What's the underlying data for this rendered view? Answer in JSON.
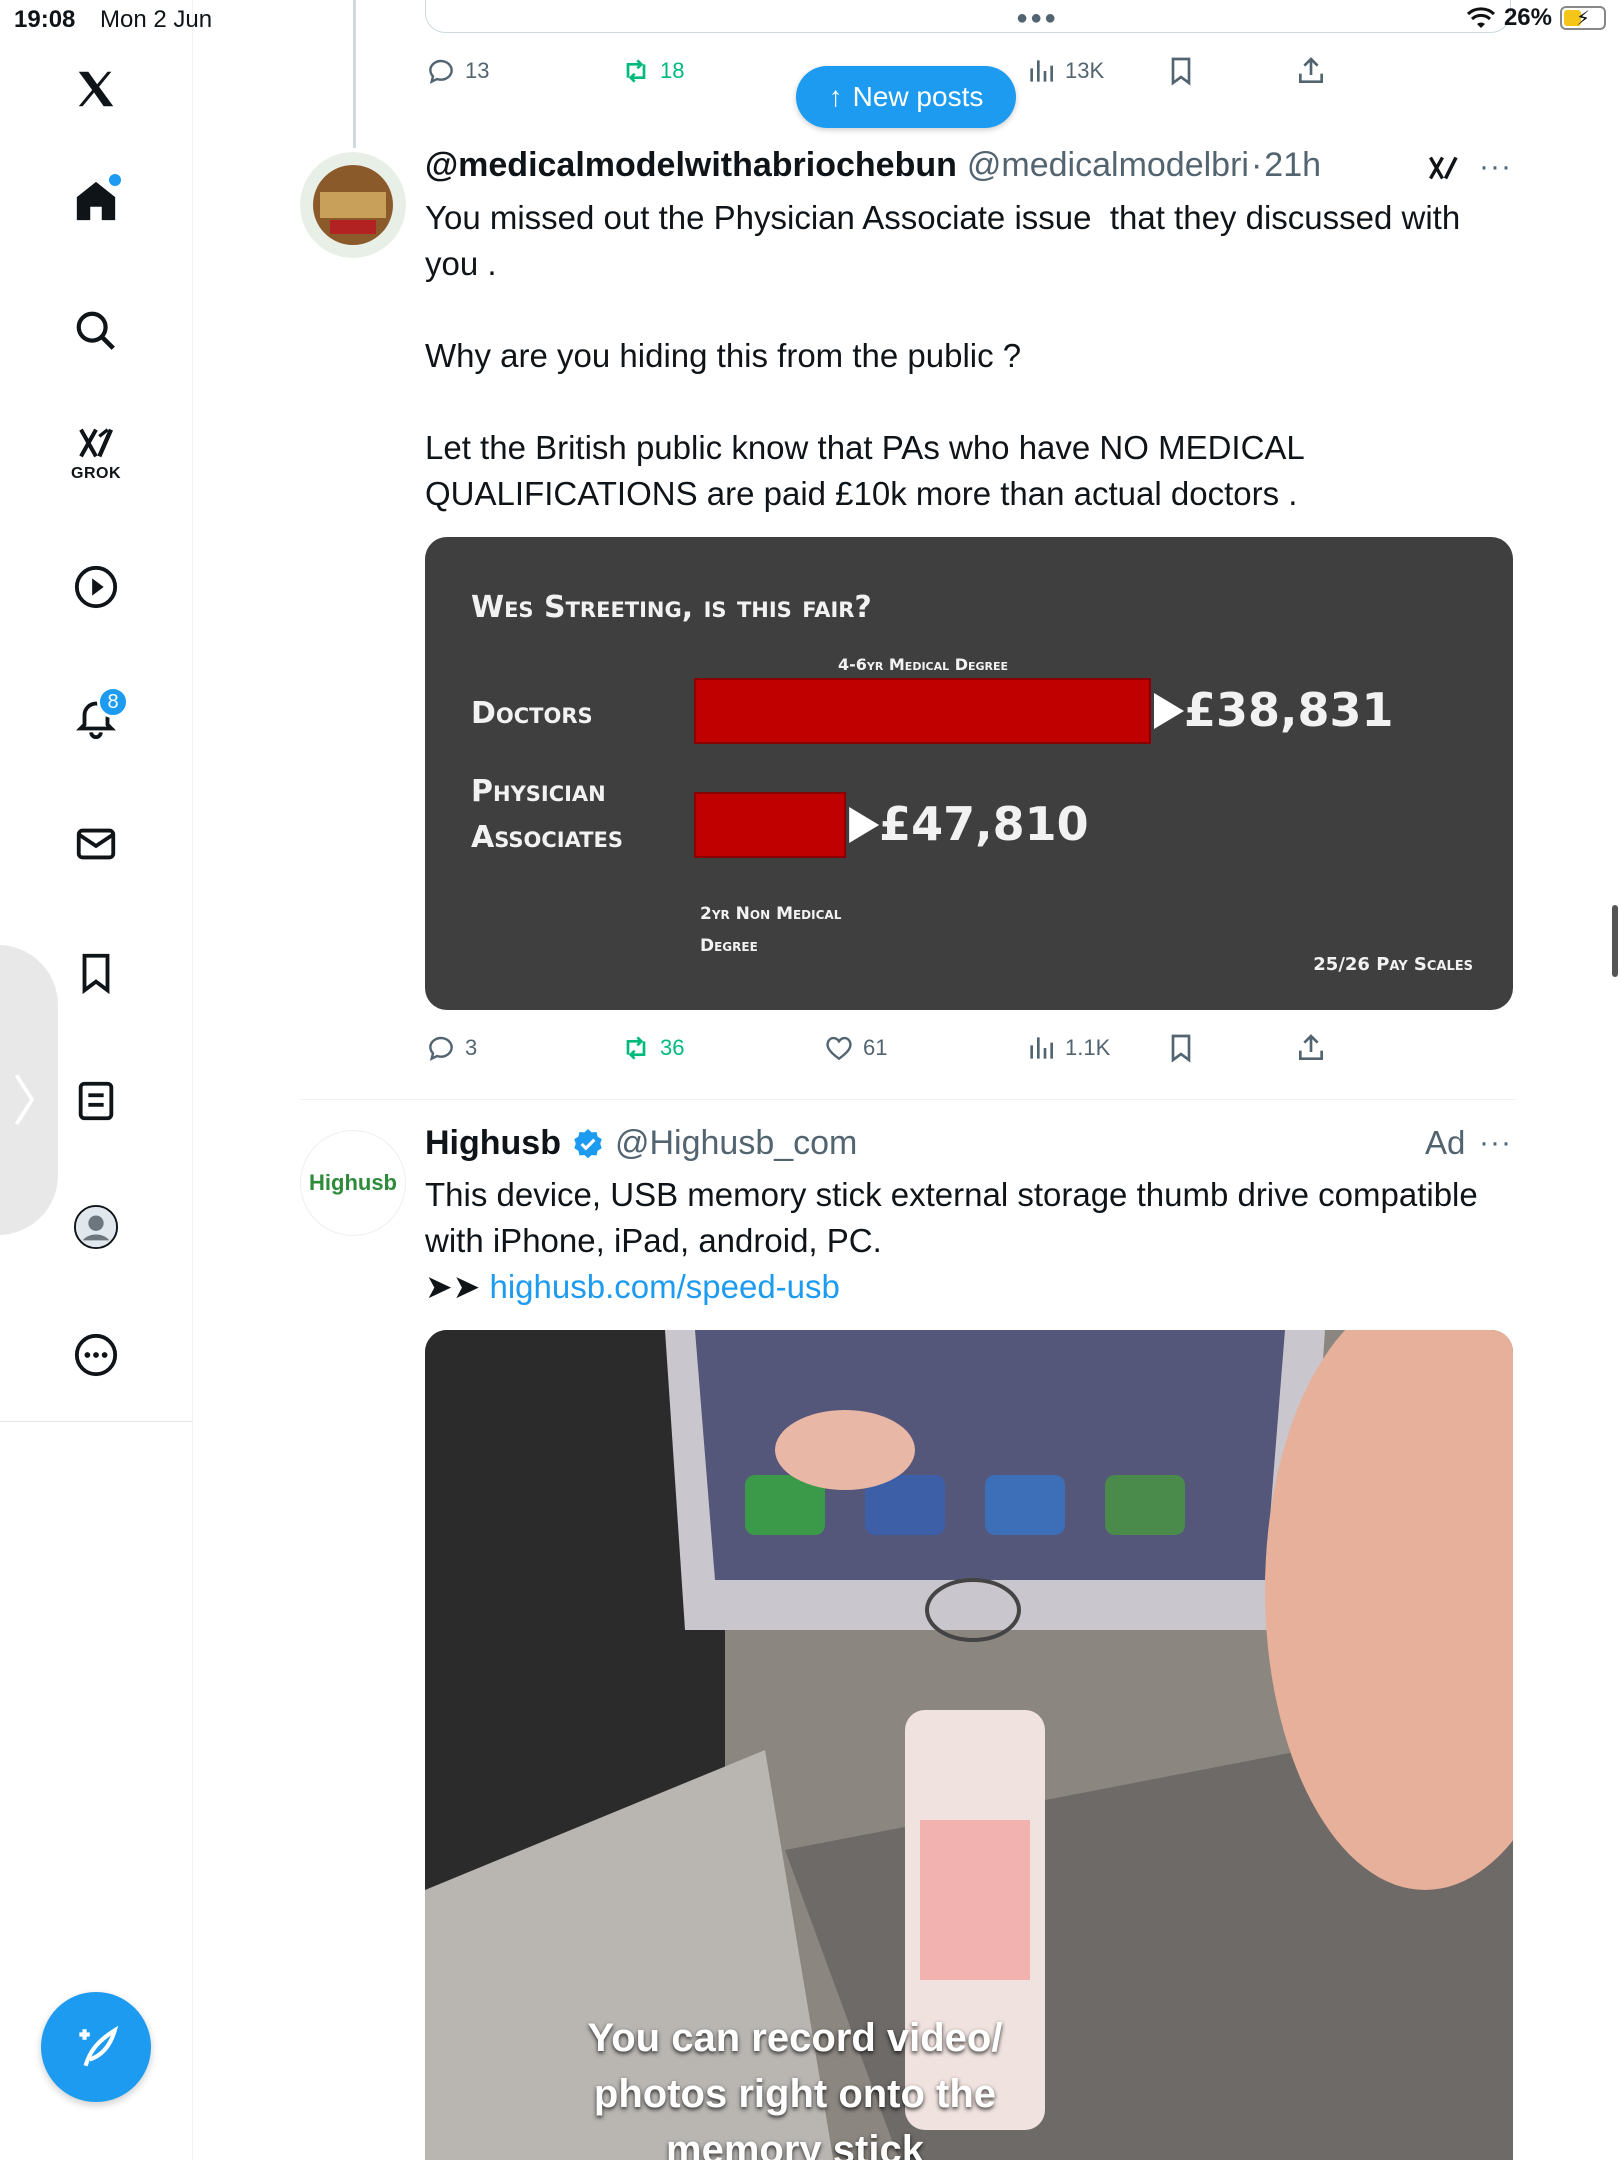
{
  "status_bar": {
    "time": "19:08",
    "date": "Mon 2 Jun",
    "battery": "26%"
  },
  "sidebar": {
    "grok_label": "GROK",
    "notifications_badge": "8"
  },
  "new_posts_label": "New posts",
  "prev_tweet_actions": {
    "replies": "13",
    "reposts": "18",
    "views": "13K"
  },
  "tweet": {
    "display_name": "@medicalmodelwithabriochebun",
    "handle": "@medicalmodelbri",
    "separator": "·",
    "time": "21h",
    "text": "You missed out the Physician Associate issue  that they discussed with you .\n\nWhy are you hiding this from the public ?\n\nLet the British public know that PAs who have NO MEDICAL QUALIFICATIONS are paid £10k more than actual doctors .",
    "actions": {
      "replies": "3",
      "reposts": "36",
      "likes": "61",
      "views": "1.1K"
    }
  },
  "chart_data": {
    "type": "bar",
    "orientation": "horizontal",
    "title": "Wes Streeting, is this fair?",
    "categories": [
      "Doctors",
      "Physician Associates"
    ],
    "values": [
      38831,
      47810
    ],
    "value_labels": [
      "£38,831",
      "£47,810"
    ],
    "bar_notes": [
      "4-6yr Medical Degree",
      "2yr Non Medical Degree"
    ],
    "footnote": "25/26 Pay Scales",
    "bar_color": "#c00000"
  },
  "ad": {
    "display_name": "Highusb",
    "handle": "@Highusb_com",
    "ad_label": "Ad",
    "avatar_text": "Highusb",
    "text_line1": "This device, USB memory stick external storage thumb drive compatible with iPhone, iPad, android, PC.",
    "arrows": "➤➤ ",
    "link": "highusb.com/speed-usb",
    "video_caption": "You can record video/ photos right onto the memory stick"
  },
  "colors": {
    "accent": "#1d9bf0",
    "repost_green": "#00ba7c",
    "muted": "#536471"
  }
}
